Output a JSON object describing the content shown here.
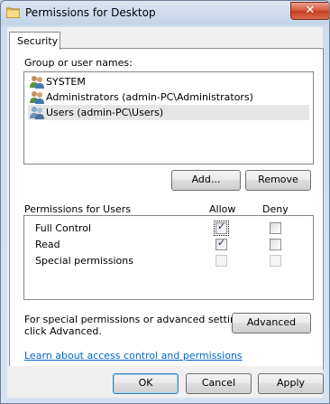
{
  "window": {
    "title": "Permissions for Desktop",
    "close_label": "✕"
  },
  "tabs": [
    {
      "label": "Security"
    }
  ],
  "group": {
    "label": "Group or user names:",
    "items": [
      {
        "label": "SYSTEM",
        "selected": false
      },
      {
        "label": "Administrators (admin-PC\\Administrators)",
        "selected": false
      },
      {
        "label": "Users (admin-PC\\Users)",
        "selected": true
      }
    ],
    "add_label": "Add...",
    "remove_label": "Remove"
  },
  "permissions": {
    "header": "Permissions for Users",
    "allow_header": "Allow",
    "deny_header": "Deny",
    "rows": [
      {
        "label": "Full Control",
        "allow": true,
        "deny": false
      },
      {
        "label": "Read",
        "allow": true,
        "deny": false
      },
      {
        "label": "Special permissions",
        "allow": false,
        "deny": false
      }
    ]
  },
  "advanced": {
    "text_line1": "For special permissions or advanced settings,",
    "text_line2": "click Advanced.",
    "button_label": "Advanced"
  },
  "link_text": "Learn about access control and permissions",
  "footer": {
    "ok": "OK",
    "cancel": "Cancel",
    "apply": "Apply"
  },
  "colors": {
    "link": "#0066cc",
    "close": "#c43d1f",
    "selection": "#e6e6e6"
  },
  "icons": {
    "window": "folder-icon",
    "users": "users-group-icon",
    "check": "checkmark"
  }
}
